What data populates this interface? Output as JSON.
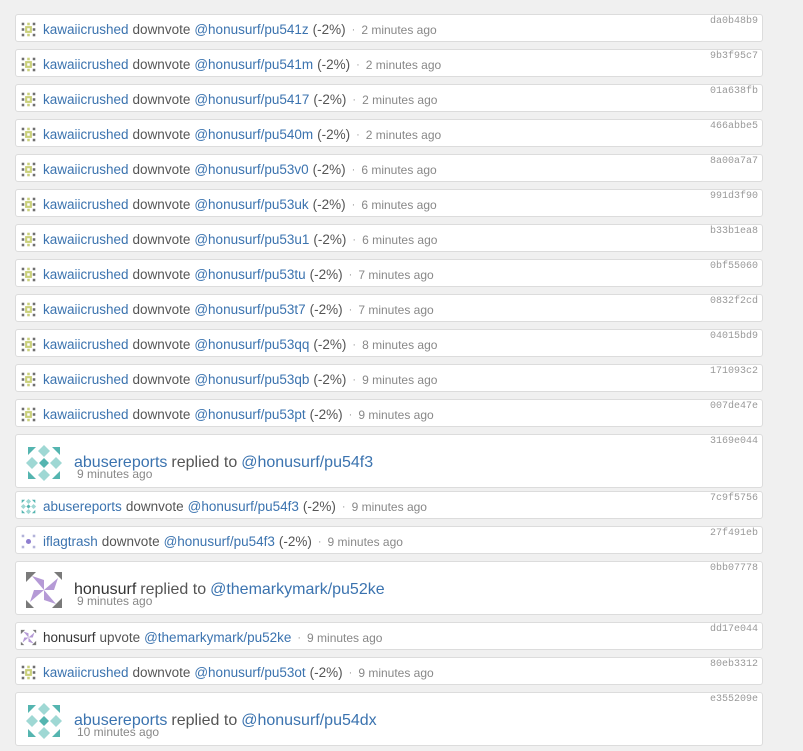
{
  "rows": [
    {
      "kind": "vote",
      "avatar": "kawaii",
      "user": "kawaiicrushed",
      "action": "downvote",
      "target": "@honusurf/pu541z",
      "weight": "(-2%)",
      "time": "2 minutes ago",
      "hash": "da0b48b9"
    },
    {
      "kind": "vote",
      "avatar": "kawaii",
      "user": "kawaiicrushed",
      "action": "downvote",
      "target": "@honusurf/pu541m",
      "weight": "(-2%)",
      "time": "2 minutes ago",
      "hash": "9b3f95c7"
    },
    {
      "kind": "vote",
      "avatar": "kawaii",
      "user": "kawaiicrushed",
      "action": "downvote",
      "target": "@honusurf/pu5417",
      "weight": "(-2%)",
      "time": "2 minutes ago",
      "hash": "01a638fb"
    },
    {
      "kind": "vote",
      "avatar": "kawaii",
      "user": "kawaiicrushed",
      "action": "downvote",
      "target": "@honusurf/pu540m",
      "weight": "(-2%)",
      "time": "2 minutes ago",
      "hash": "466abbe5"
    },
    {
      "kind": "vote",
      "avatar": "kawaii",
      "user": "kawaiicrushed",
      "action": "downvote",
      "target": "@honusurf/pu53v0",
      "weight": "(-2%)",
      "time": "6 minutes ago",
      "hash": "8a00a7a7"
    },
    {
      "kind": "vote",
      "avatar": "kawaii",
      "user": "kawaiicrushed",
      "action": "downvote",
      "target": "@honusurf/pu53uk",
      "weight": "(-2%)",
      "time": "6 minutes ago",
      "hash": "991d3f90"
    },
    {
      "kind": "vote",
      "avatar": "kawaii",
      "user": "kawaiicrushed",
      "action": "downvote",
      "target": "@honusurf/pu53u1",
      "weight": "(-2%)",
      "time": "6 minutes ago",
      "hash": "b33b1ea8"
    },
    {
      "kind": "vote",
      "avatar": "kawaii",
      "user": "kawaiicrushed",
      "action": "downvote",
      "target": "@honusurf/pu53tu",
      "weight": "(-2%)",
      "time": "7 minutes ago",
      "hash": "0bf55060"
    },
    {
      "kind": "vote",
      "avatar": "kawaii",
      "user": "kawaiicrushed",
      "action": "downvote",
      "target": "@honusurf/pu53t7",
      "weight": "(-2%)",
      "time": "7 minutes ago",
      "hash": "0832f2cd"
    },
    {
      "kind": "vote",
      "avatar": "kawaii",
      "user": "kawaiicrushed",
      "action": "downvote",
      "target": "@honusurf/pu53qq",
      "weight": "(-2%)",
      "time": "8 minutes ago",
      "hash": "04015bd9"
    },
    {
      "kind": "vote",
      "avatar": "kawaii",
      "user": "kawaiicrushed",
      "action": "downvote",
      "target": "@honusurf/pu53qb",
      "weight": "(-2%)",
      "time": "9 minutes ago",
      "hash": "171093c2"
    },
    {
      "kind": "vote",
      "avatar": "kawaii",
      "user": "kawaiicrushed",
      "action": "downvote",
      "target": "@honusurf/pu53pt",
      "weight": "(-2%)",
      "time": "9 minutes ago",
      "hash": "007de47e"
    },
    {
      "kind": "reply",
      "avatar": "abuse",
      "user": "abusereports",
      "action": "replied to",
      "target": "@honusurf/pu54f3",
      "time": "9 minutes ago",
      "hash": "3169e044"
    },
    {
      "kind": "vote",
      "avatar": "abuse",
      "user": "abusereports",
      "action": "downvote",
      "target": "@honusurf/pu54f3",
      "weight": "(-2%)",
      "time": "9 minutes ago",
      "hash": "7c9f5756"
    },
    {
      "kind": "vote",
      "avatar": "iflag",
      "user": "iflagtrash",
      "action": "downvote",
      "target": "@honusurf/pu54f3",
      "weight": "(-2%)",
      "time": "9 minutes ago",
      "hash": "27f491eb"
    },
    {
      "kind": "reply",
      "avatar": "honu",
      "user": "honusurf",
      "action": "replied to",
      "target": "@themarkymark/pu52ke",
      "time": "9 minutes ago",
      "hash": "0bb07778"
    },
    {
      "kind": "vote",
      "avatar": "honu",
      "user": "honusurf",
      "action": "upvote",
      "target": "@themarkymark/pu52ke",
      "weight": "",
      "time": "9 minutes ago",
      "hash": "dd17e044"
    },
    {
      "kind": "vote",
      "avatar": "kawaii",
      "user": "kawaiicrushed",
      "action": "downvote",
      "target": "@honusurf/pu53ot",
      "weight": "(-2%)",
      "time": "9 minutes ago",
      "hash": "80eb3312"
    },
    {
      "kind": "reply",
      "avatar": "abuse",
      "user": "abusereports",
      "action": "replied to",
      "target": "@honusurf/pu54dx",
      "time": "10 minutes ago",
      "hash": "e355209e"
    }
  ]
}
